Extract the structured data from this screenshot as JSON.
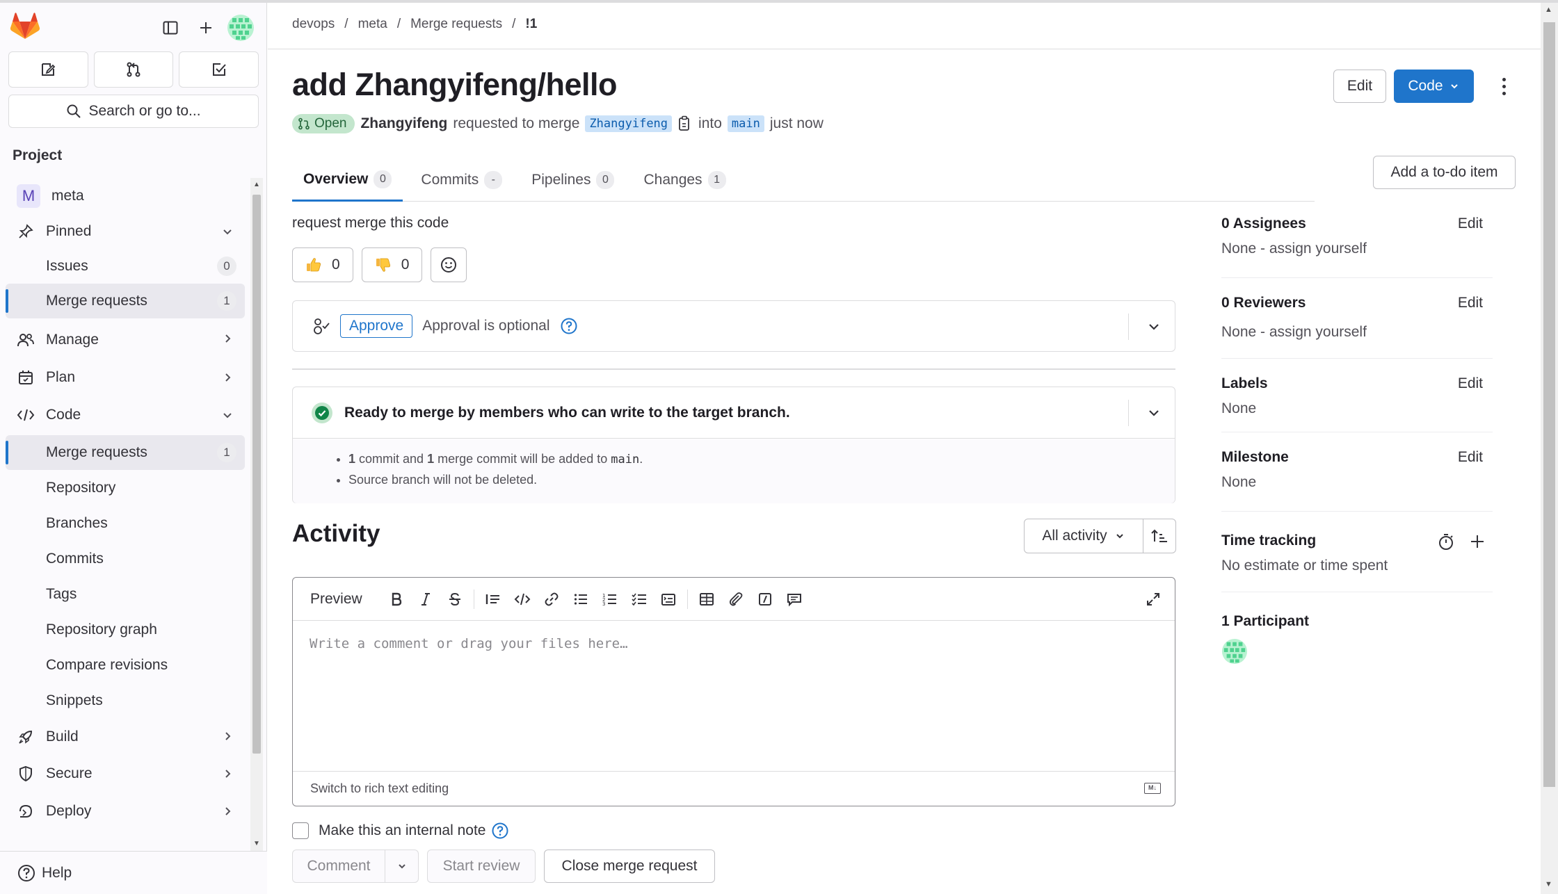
{
  "sidebar": {
    "search_label": "Search or go to...",
    "section_label": "Project",
    "project_initial": "M",
    "project_name": "meta",
    "items": [
      {
        "label": "Pinned",
        "icon": "pin-icon"
      },
      {
        "label": "Issues",
        "count": "0"
      },
      {
        "label": "Merge requests",
        "count": "1"
      },
      {
        "label": "Manage",
        "icon": "users-icon"
      },
      {
        "label": "Plan",
        "icon": "calendar-icon"
      },
      {
        "label": "Code",
        "icon": "code-icon"
      },
      {
        "label": "Merge requests",
        "count": "1"
      },
      {
        "label": "Repository"
      },
      {
        "label": "Branches"
      },
      {
        "label": "Commits"
      },
      {
        "label": "Tags"
      },
      {
        "label": "Repository graph"
      },
      {
        "label": "Compare revisions"
      },
      {
        "label": "Snippets"
      },
      {
        "label": "Build",
        "icon": "rocket-icon"
      },
      {
        "label": "Secure",
        "icon": "shield-icon"
      },
      {
        "label": "Deploy",
        "icon": "deploy-icon"
      }
    ],
    "help_label": "Help"
  },
  "breadcrumb": [
    "devops",
    "meta",
    "Merge requests",
    "!1"
  ],
  "mr": {
    "title": "add Zhangyifeng/hello",
    "status": "Open",
    "author": "Zhangyifeng",
    "requested_text": "requested to merge",
    "source_branch": "Zhangyifeng",
    "into_text": "into",
    "target_branch": "main",
    "time": "just now",
    "edit_label": "Edit",
    "code_label": "Code",
    "todo_label": "Add a to-do item",
    "description": "request merge this code"
  },
  "tabs": [
    {
      "label": "Overview",
      "count": "0"
    },
    {
      "label": "Commits",
      "count": "-"
    },
    {
      "label": "Pipelines",
      "count": "0"
    },
    {
      "label": "Changes",
      "count": "1"
    }
  ],
  "reactions": {
    "thumbs_up": "0",
    "thumbs_down": "0"
  },
  "approval": {
    "button": "Approve",
    "text": "Approval is optional"
  },
  "merge": {
    "status": "Ready to merge by members who can write to the target branch.",
    "line1_a": "1",
    "line1_b": "commit and",
    "line1_c": "1",
    "line1_d": "merge commit will be added to",
    "line1_branch": "main",
    "line2": "Source branch will not be deleted."
  },
  "activity": {
    "title": "Activity",
    "filter": "All activity"
  },
  "editor": {
    "preview_label": "Preview",
    "placeholder": "Write a comment or drag your files here…",
    "rich_text_label": "Switch to rich text editing",
    "md_label": "M↓"
  },
  "comment_form": {
    "internal_note": "Make this an internal note",
    "comment": "Comment",
    "start_review": "Start review",
    "close_mr": "Close merge request"
  },
  "right_sidebar": {
    "assignees_title": "0 Assignees",
    "assignees_value": "None - assign yourself",
    "reviewers_title": "0 Reviewers",
    "reviewers_value": "None - assign yourself",
    "labels_title": "Labels",
    "labels_value": "None",
    "milestone_title": "Milestone",
    "milestone_value": "None",
    "time_title": "Time tracking",
    "time_value": "No estimate or time spent",
    "participants_title": "1 Participant",
    "edit_label": "Edit"
  },
  "colors": {
    "accent": "#1f75cb",
    "success": "#108548",
    "brand": "#e24329"
  }
}
